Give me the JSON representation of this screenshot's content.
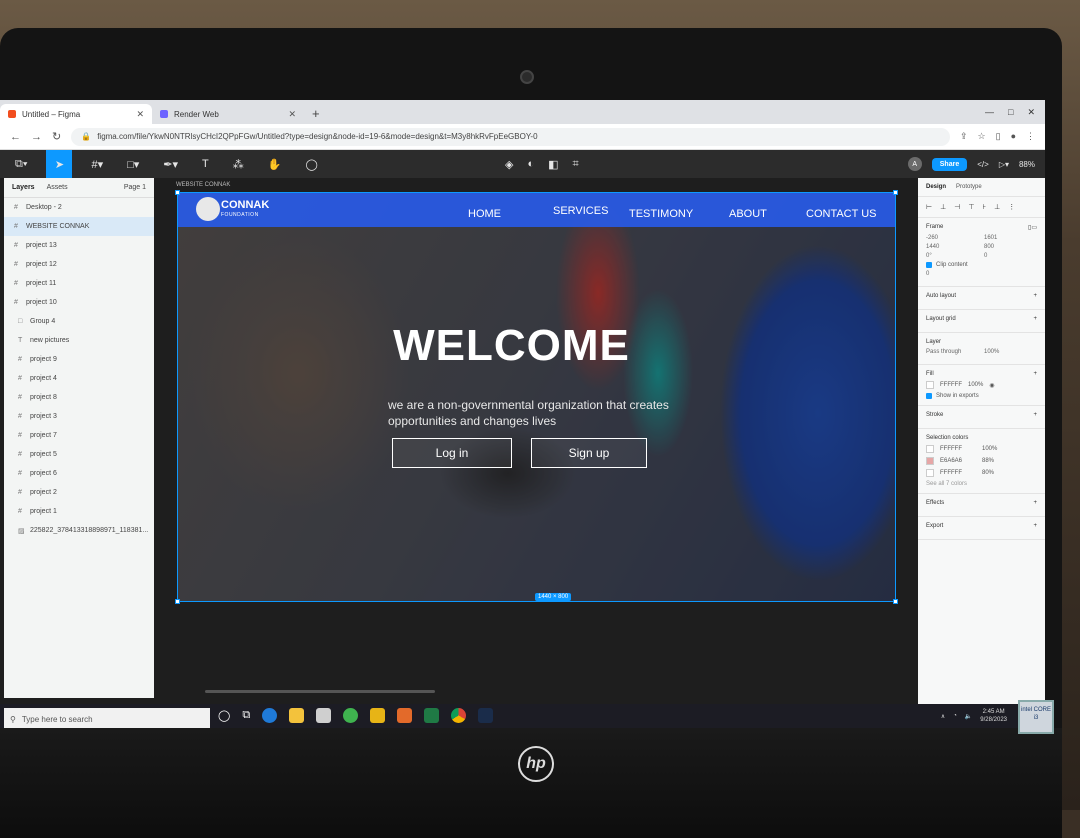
{
  "browser": {
    "tabs": [
      {
        "title": "Untitled – Figma",
        "active": true,
        "favicon_color": "#f24e1e"
      },
      {
        "title": "Render Web",
        "active": false,
        "favicon_color": "#6c63ff"
      }
    ],
    "new_tab_label": "+",
    "url": "figma.com/file/YkwN0NTRlsyCHcI2QPpFGw/Untitled?type=design&node-id=19-6&mode=design&t=M3y8hkRvFpEeGBOY-0",
    "window_controls": [
      "—",
      "□",
      "✕"
    ]
  },
  "figma": {
    "toolbar_zoom": "88%",
    "avatar_initial": "A",
    "share_label": "Share",
    "layers_panel": {
      "tabs": [
        "Layers",
        "Assets"
      ],
      "page": "Page 1",
      "items": [
        {
          "name": "Desktop - 2",
          "icon": "#",
          "level": 0,
          "selected": false
        },
        {
          "name": "WEBSITE CONNAK",
          "icon": "#",
          "level": 0,
          "selected": true
        },
        {
          "name": "project 13",
          "icon": "#",
          "level": 0,
          "selected": false
        },
        {
          "name": "project 12",
          "icon": "#",
          "level": 0,
          "selected": false
        },
        {
          "name": "project 11",
          "icon": "#",
          "level": 0,
          "selected": false
        },
        {
          "name": "project 10",
          "icon": "#",
          "level": 0,
          "selected": false
        },
        {
          "name": "Group 4",
          "icon": "□",
          "level": 1,
          "selected": false
        },
        {
          "name": "new pictures",
          "icon": "T",
          "level": 1,
          "selected": false
        },
        {
          "name": "project 9",
          "icon": "#",
          "level": 1,
          "selected": false
        },
        {
          "name": "project 4",
          "icon": "#",
          "level": 1,
          "selected": false
        },
        {
          "name": "project 8",
          "icon": "#",
          "level": 1,
          "selected": false
        },
        {
          "name": "project 3",
          "icon": "#",
          "level": 1,
          "selected": false
        },
        {
          "name": "project 7",
          "icon": "#",
          "level": 1,
          "selected": false
        },
        {
          "name": "project 5",
          "icon": "#",
          "level": 1,
          "selected": false
        },
        {
          "name": "project 6",
          "icon": "#",
          "level": 1,
          "selected": false
        },
        {
          "name": "project 2",
          "icon": "#",
          "level": 1,
          "selected": false
        },
        {
          "name": "project 1",
          "icon": "#",
          "level": 1,
          "selected": false
        },
        {
          "name": "225822_378413318898971_118381...",
          "icon": "▨",
          "level": 1,
          "selected": false
        }
      ]
    },
    "frame_label": "WEBSITE CONNAK",
    "frame_size_tag": "1440 × 800",
    "design_panel": {
      "tabs": [
        "Design",
        "Prototype"
      ],
      "frame_title": "Frame",
      "x": "-260",
      "y": "1601",
      "w": "1440",
      "h": "800",
      "rotation": "0°",
      "radius": "0",
      "clip_content": "Clip content",
      "layout_value": "0",
      "auto_layout": "Auto layout",
      "layout_grid": "Layout grid",
      "layer_title": "Layer",
      "blend_mode": "Pass through",
      "layer_opacity": "100%",
      "fill_title": "Fill",
      "fill_hex": "FFFFFF",
      "fill_opacity": "100%",
      "show_in_exports": "Show in exports",
      "stroke_title": "Stroke",
      "selection_colors_title": "Selection colors",
      "selection_colors": [
        {
          "hex": "FFFFFF",
          "opacity": "100%",
          "color": "#FFFFFF"
        },
        {
          "hex": "E6A6A6",
          "opacity": "88%",
          "color": "#E6A6A6"
        },
        {
          "hex": "FFFFFF",
          "opacity": "80%",
          "color": "#FFFFFF"
        }
      ],
      "see_all": "See all 7 colors",
      "effects_title": "Effects",
      "export_title": "Export",
      "help": "?"
    }
  },
  "website": {
    "logo_name": "CONNAK",
    "logo_sub": "FOUNDATION",
    "nav": [
      "HOME",
      "SERVICES",
      "TESTIMONY",
      "ABOUT",
      "CONTACT US"
    ],
    "hero_title": "WELCOME",
    "hero_subtitle": "we are a non-governmental organization that creates opportunities and changes lives",
    "login_label": "Log in",
    "signup_label": "Sign up",
    "nav_color": "#2a5ae6"
  },
  "taskbar": {
    "search_placeholder": "Type here to search",
    "time": "2:45 AM",
    "date": "9/28/2023"
  },
  "device": {
    "brand": "hp",
    "badge": "intel CORE i3"
  }
}
